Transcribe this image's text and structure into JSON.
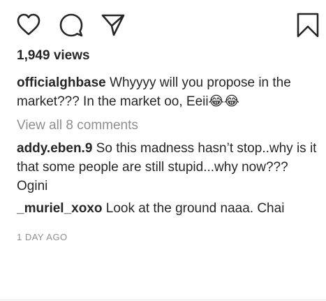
{
  "actions": {
    "like_icon": "heart-outline",
    "comment_icon": "speech-bubble-outline",
    "share_icon": "paper-plane-outline",
    "save_icon": "bookmark-outline"
  },
  "post": {
    "views": "1,949 views",
    "caption": {
      "username": "officialghbase",
      "text": " Whyyyy will you propose in the market??? In the market oo, Eeii😂😂"
    },
    "view_all_comments": "View all 8 comments",
    "comments": [
      {
        "username": "addy.eben.9",
        "text": " So this madness hasn’t stop..why is it that some people are still stupid...why now???Ogini"
      },
      {
        "username": "_muriel_xoxo",
        "text": " Look at the ground naaa. Chai"
      }
    ],
    "timestamp": "1 DAY AGO"
  }
}
